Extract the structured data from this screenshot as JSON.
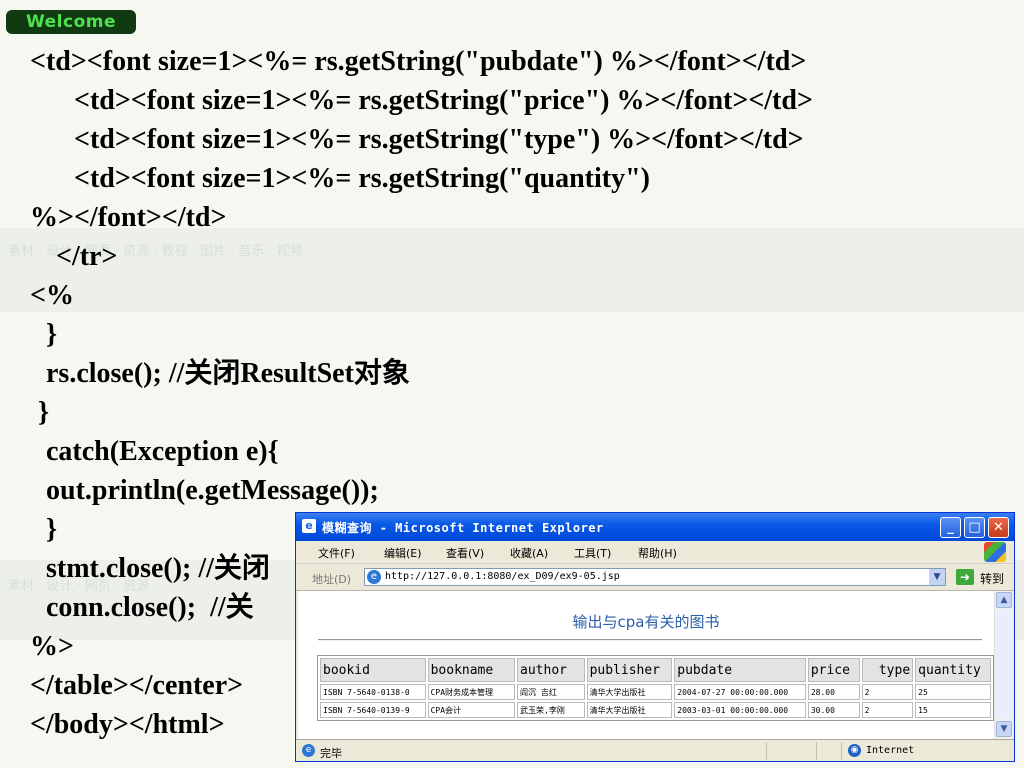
{
  "slide": {
    "badge": "Welcome",
    "code_lines": [
      "<td><font size=1><%= rs.getString(\"pubdate\") %></font></td>",
      "<td><font size=1><%= rs.getString(\"price\") %></font></td>",
      "<td><font size=1><%= rs.getString(\"type\") %></font></td>",
      "<td><font size=1><%= rs.getString(\"quantity\")",
      "%></font></td>",
      "</tr>",
      "<%",
      "}",
      "rs.close(); //关闭ResultSet对象",
      "}",
      "catch(Exception e){",
      "out.println(e.getMessage());",
      "}",
      "stmt.close(); //关闭",
      "conn.close();  //关",
      "%>",
      "</table></center>",
      "</body></html>"
    ]
  },
  "browser": {
    "title": "模糊查询 - Microsoft Internet Explorer",
    "window_buttons": {
      "minimize": "_",
      "maximize": "□",
      "close": "✕"
    },
    "menu": [
      "文件(F)",
      "编辑(E)",
      "查看(V)",
      "收藏(A)",
      "工具(T)",
      "帮助(H)"
    ],
    "address_label": "地址(D)",
    "address_url": "http://127.0.0.1:8080/ex_D09/ex9-05.jsp",
    "go_label": "转到",
    "page_heading": "输出与cpa有关的图书",
    "table": {
      "headers": [
        "bookid",
        "bookname",
        "author",
        "publisher",
        "pubdate",
        "price",
        "type",
        "quantity"
      ],
      "rows": [
        [
          "ISBN 7-5640-0138-0",
          "CPA财务成本管理",
          "阎沉 吉红",
          "清华大学出版社",
          "2004-07-27 00:00:00.000",
          "28.00",
          "2",
          "25"
        ],
        [
          "ISBN 7-5640-0139-9",
          "CPA会计",
          "武玉荣,李刚",
          "清华大学出版社",
          "2003-03-01 00:00:00.000",
          "30.00",
          "2",
          "15"
        ]
      ]
    },
    "status_text": "完毕",
    "zone_text": "Internet"
  }
}
